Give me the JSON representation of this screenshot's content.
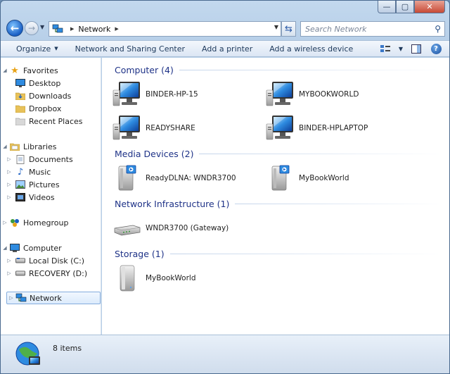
{
  "window": {
    "caption_buttons": {
      "minimize": "—",
      "maximize": "▢",
      "close": "✕"
    }
  },
  "navbar": {
    "back_icon": "back-arrow-icon",
    "forward_icon": "forward-arrow-icon",
    "address_crumbs": [
      "Network"
    ],
    "search_placeholder": "Search Network"
  },
  "toolbar": {
    "organize": "Organize",
    "network_center": "Network and Sharing Center",
    "add_printer": "Add a printer",
    "add_wireless": "Add a wireless device"
  },
  "sidebar": {
    "favorites": {
      "label": "Favorites",
      "items": [
        "Desktop",
        "Downloads",
        "Dropbox",
        "Recent Places"
      ]
    },
    "libraries": {
      "label": "Libraries",
      "items": [
        "Documents",
        "Music",
        "Pictures",
        "Videos"
      ]
    },
    "homegroup": "Homegroup",
    "computer": {
      "label": "Computer",
      "items": [
        "Local Disk (C:)",
        "RECOVERY (D:)"
      ]
    },
    "network": "Network"
  },
  "groups": {
    "computer": {
      "title": "Computer (4)",
      "items": [
        "BINDER-HP-15",
        "MYBOOKWORLD",
        "READYSHARE",
        "BINDER-HPLAPTOP"
      ]
    },
    "media": {
      "title": "Media Devices (2)",
      "items": [
        "ReadyDLNA: WNDR3700",
        "MyBookWorld"
      ]
    },
    "infra": {
      "title": "Network Infrastructure (1)",
      "items": [
        "WNDR3700 (Gateway)"
      ]
    },
    "storage": {
      "title": "Storage (1)",
      "items": [
        "MyBookWorld"
      ]
    }
  },
  "status": {
    "count": "8 items"
  },
  "colors": {
    "group_header": "#1e3287",
    "accent": "#1a5fc4"
  }
}
